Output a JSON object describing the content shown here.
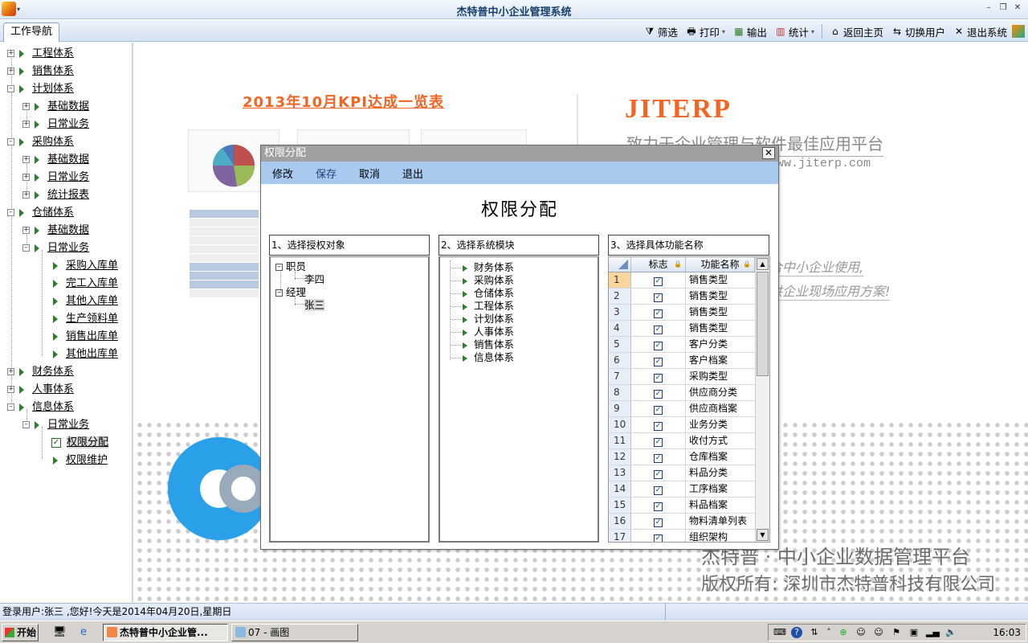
{
  "window": {
    "title": "杰特普中小企业管理系统"
  },
  "nav_tab": "工作导航",
  "toolbar": {
    "filter": "筛选",
    "print": "打印",
    "export": "输出",
    "stats": "统计",
    "home": "返回主页",
    "switch_user": "切换用户",
    "exit": "退出系统"
  },
  "sidebar": {
    "eng": "工程体系",
    "sales": "销售体系",
    "plan": "计划体系",
    "plan_basic": "基础数据",
    "plan_daily": "日常业务",
    "purchase": "采购体系",
    "pur_basic": "基础数据",
    "pur_daily": "日常业务",
    "pur_report": "统计报表",
    "storage": "仓储体系",
    "sto_basic": "基础数据",
    "sto_daily": "日常业务",
    "sto_in_purchase": "采购入库单",
    "sto_in_finish": "完工入库单",
    "sto_in_other": "其他入库单",
    "sto_pick": "生产领料单",
    "sto_out_sales": "销售出库单",
    "sto_out_other": "其他出库单",
    "finance": "财务体系",
    "hr": "人事体系",
    "info": "信息体系",
    "info_daily": "日常业务",
    "perm_assign": "权限分配",
    "perm_maint": "权限维护"
  },
  "background": {
    "kpi_title": "2013年10月KPI达成一览表",
    "logo": "JITERP",
    "slogan": "致力于企业管理与软件最佳应用平台",
    "url": "www.jiterp.com",
    "line1": "合中小企业使用,",
    "line2": "供企业现场应用方案!",
    "bottom1": "杰特普 · 中小企业数据管理平台",
    "bottom2": "版权所有: 深圳市杰特普科技有限公司"
  },
  "dialog": {
    "title": "权限分配",
    "menu": {
      "edit": "修改",
      "save": "保存",
      "cancel": "取消",
      "exit": "退出"
    },
    "heading": "权限分配",
    "panel1": {
      "header": "1、选择授权对象",
      "group1": "职员",
      "group1_item": "李四",
      "group2": "经理",
      "group2_item": "张三"
    },
    "panel2": {
      "header": "2、选择系统模块",
      "items": [
        "财务体系",
        "采购体系",
        "仓储体系",
        "工程体系",
        "计划体系",
        "人事体系",
        "销售体系",
        "信息体系"
      ]
    },
    "panel3": {
      "header": "3、选择具体功能名称",
      "col_flag": "标志",
      "col_name": "功能名称",
      "rows": [
        {
          "n": "1",
          "name": "销售类型",
          "checked": true
        },
        {
          "n": "2",
          "name": "销售类型",
          "checked": true
        },
        {
          "n": "3",
          "name": "销售类型",
          "checked": true
        },
        {
          "n": "4",
          "name": "销售类型",
          "checked": true
        },
        {
          "n": "5",
          "name": "客户分类",
          "checked": true
        },
        {
          "n": "6",
          "name": "客户档案",
          "checked": true
        },
        {
          "n": "7",
          "name": "采购类型",
          "checked": true
        },
        {
          "n": "8",
          "name": "供应商分类",
          "checked": true
        },
        {
          "n": "9",
          "name": "供应商档案",
          "checked": true
        },
        {
          "n": "10",
          "name": "业务分类",
          "checked": true
        },
        {
          "n": "11",
          "name": "收付方式",
          "checked": true
        },
        {
          "n": "12",
          "name": "仓库档案",
          "checked": true
        },
        {
          "n": "13",
          "name": "料品分类",
          "checked": true
        },
        {
          "n": "14",
          "name": "工序档案",
          "checked": true
        },
        {
          "n": "15",
          "name": "料品档案",
          "checked": true
        },
        {
          "n": "16",
          "name": "物料清单列表",
          "checked": true
        },
        {
          "n": "17",
          "name": "组织架构",
          "checked": true
        }
      ]
    }
  },
  "status": "登录用户:张三 ,您好!今天是2014年04月20日,星期日",
  "taskbar": {
    "start": "开始",
    "task1": "杰特普中小企业管...",
    "task2": "07 - 画图",
    "clock": "16:03"
  }
}
